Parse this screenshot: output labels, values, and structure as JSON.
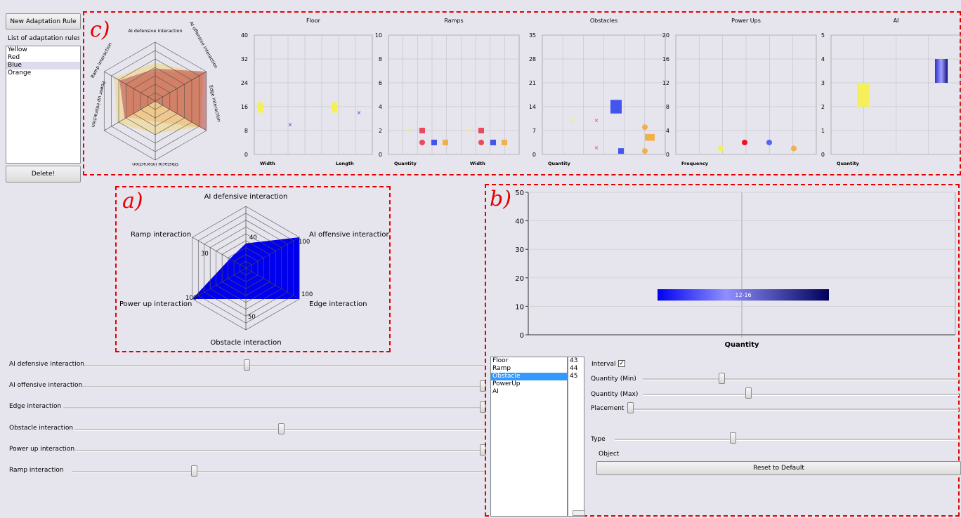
{
  "sidebar": {
    "new_rule_button": "New Adaptation Rule",
    "list_label": "List of adaptation rules",
    "rules": [
      "Yellow",
      "Red",
      "Blue",
      "Orange"
    ],
    "delete_button": "Delete!"
  },
  "panel_labels": {
    "a": "a)",
    "b": "b)",
    "c": "c)"
  },
  "radar_small": {
    "axes": [
      "AI defensive interaction",
      "AI offensive interaction",
      "Edge interaction",
      "Obstacle interaction",
      "Power up interaction",
      "Ramp interaction"
    ],
    "colors": {
      "yellow": "#f2d77a",
      "red": "#c0504d",
      "orange": "#f0a050"
    }
  },
  "radar_main": {
    "axes": [
      "AI defensive interaction",
      "AI offensive interaction",
      "Edge interaction",
      "Obstacle interaction",
      "Power up interaction",
      "Ramp interaction"
    ],
    "values": [
      40,
      100,
      100,
      50,
      100,
      30
    ],
    "value_labels": [
      "40",
      "100",
      "100",
      "50",
      "100",
      "30"
    ],
    "fill": "#0000ee"
  },
  "mini_charts": [
    {
      "title": "Floor",
      "yticks": [
        "0",
        "8",
        "16",
        "24",
        "32",
        "40"
      ],
      "xlabels": [
        "Width",
        "Length"
      ]
    },
    {
      "title": "Ramps",
      "yticks": [
        "0",
        "2",
        "4",
        "6",
        "8",
        "10"
      ],
      "xlabels": [
        "Quantity",
        "Width"
      ]
    },
    {
      "title": "Obstacles",
      "yticks": [
        "0",
        "7",
        "14",
        "21",
        "28",
        "35"
      ],
      "xlabels": [
        "Quantity"
      ]
    },
    {
      "title": "Power Ups",
      "yticks": [
        "0",
        "4",
        "8",
        "12",
        "16",
        "20"
      ],
      "xlabels": [
        "Frequency"
      ]
    },
    {
      "title": "AI",
      "yticks": [
        "0",
        "1",
        "2",
        "3",
        "4",
        "5"
      ],
      "xlabels": [
        "Quantity"
      ]
    }
  ],
  "chart_data": [
    {
      "type": "scatter",
      "title": "Floor",
      "ylim": [
        0,
        40
      ],
      "categories": [
        "Width",
        "Length"
      ],
      "series": [
        {
          "name": "Yellow",
          "values": [
            16,
            16
          ]
        },
        {
          "name": "Blue",
          "values": [
            10,
            14
          ]
        }
      ]
    },
    {
      "type": "scatter",
      "title": "Ramps",
      "ylim": [
        0,
        10
      ],
      "categories": [
        "Quantity",
        "Width"
      ],
      "series": [
        {
          "name": "Yellow",
          "values": [
            2,
            2
          ]
        },
        {
          "name": "Red",
          "values": [
            2,
            2
          ]
        },
        {
          "name": "Blue",
          "values": [
            1,
            1
          ]
        },
        {
          "name": "Orange",
          "values": [
            1,
            1
          ]
        }
      ]
    },
    {
      "type": "scatter",
      "title": "Obstacles",
      "ylim": [
        0,
        35
      ],
      "categories": [
        "Quantity"
      ],
      "series": [
        {
          "name": "Yellow",
          "values": [
            10
          ]
        },
        {
          "name": "Red",
          "values": [
            10,
            2
          ]
        },
        {
          "name": "Blue",
          "values": [
            14,
            1
          ]
        },
        {
          "name": "Orange",
          "values": [
            8,
            5,
            1
          ]
        }
      ]
    },
    {
      "type": "scatter",
      "title": "Power Ups",
      "ylim": [
        0,
        20
      ],
      "categories": [
        "Frequency"
      ],
      "series": [
        {
          "name": "Yellow",
          "values": [
            1
          ]
        },
        {
          "name": "Red",
          "values": [
            2
          ]
        },
        {
          "name": "Blue",
          "values": [
            2
          ]
        },
        {
          "name": "Orange",
          "values": [
            1
          ]
        }
      ]
    },
    {
      "type": "bar",
      "title": "AI",
      "ylim": [
        0,
        5
      ],
      "categories": [
        "Quantity"
      ],
      "series": [
        {
          "name": "Yellow",
          "range": [
            2,
            3
          ]
        },
        {
          "name": "Blue",
          "range": [
            3,
            4
          ]
        }
      ]
    },
    {
      "type": "bar",
      "title": "",
      "xlabel": "Quantity",
      "ylim": [
        0,
        50
      ],
      "yticks": [
        0,
        10,
        20,
        30,
        40,
        50
      ],
      "series": [
        {
          "name": "",
          "range": [
            12,
            16
          ],
          "label": "12-16"
        }
      ]
    }
  ],
  "sliders": [
    {
      "label": "AI defensive interaction",
      "value": 0.42
    },
    {
      "label": "AI offensive interaction",
      "value": 1.0
    },
    {
      "label": "Edge interaction",
      "value": 1.0
    },
    {
      "label": "Obstacle interaction",
      "value": 0.5
    },
    {
      "label": "Power up interaction",
      "value": 1.0
    },
    {
      "label": "Ramp interaction",
      "value": 0.3
    }
  ],
  "big_chart": {
    "xlabel": "Quantity",
    "yticks": [
      "0",
      "10",
      "20",
      "30",
      "40",
      "50"
    ],
    "bar_label": "12-16"
  },
  "element_list": {
    "items": [
      "Floor",
      "Ramp",
      "Obstacle",
      "PowerUp",
      "AI"
    ],
    "selected": "Obstacle",
    "ids": [
      "43",
      "44",
      "45"
    ]
  },
  "settings": {
    "interval_label": "Interval",
    "interval_checked": true,
    "quantity_min_label": "Quantity (Min)",
    "quantity_max_label": "Quantity (Max)",
    "placement_label": "Placement",
    "type_label": "Type",
    "object_label": "Object",
    "reset_button": "Reset to Default"
  }
}
